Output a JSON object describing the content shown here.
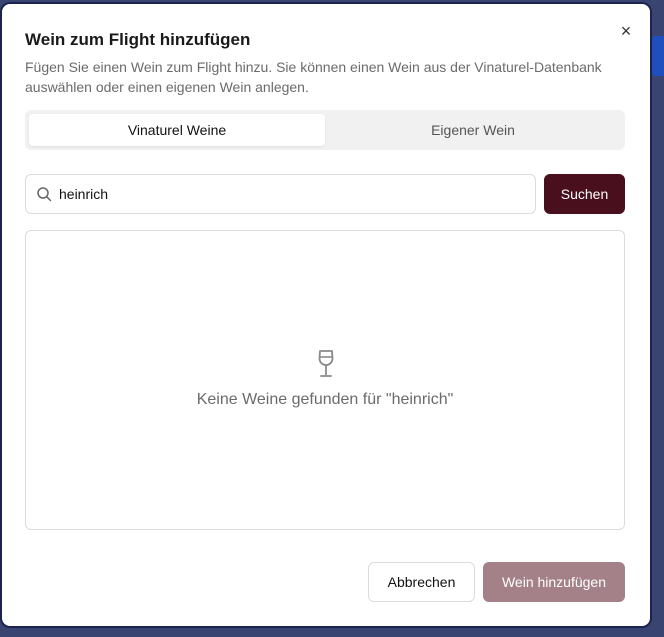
{
  "dialog": {
    "title": "Wein zum Flight hinzufügen",
    "description": "Fügen Sie einen Wein zum Flight hinzu. Sie können einen Wein aus der Vinaturel-Datenbank auswählen oder einen eigenen Wein anlegen.",
    "close_label": "×"
  },
  "tabs": [
    {
      "label": "Vinaturel Weine",
      "active": true
    },
    {
      "label": "Eigener Wein",
      "active": false
    }
  ],
  "search": {
    "value": "heinrich",
    "placeholder": "",
    "button_label": "Suchen"
  },
  "results": {
    "empty_message": "Keine Weine gefunden für \"heinrich\""
  },
  "footer": {
    "cancel_label": "Abbrechen",
    "add_label": "Wein hinzufügen"
  },
  "colors": {
    "primary": "#4a0f1c",
    "primary_disabled": "#a48189",
    "border": "#dcdcdc"
  },
  "icons": [
    "search-icon",
    "wine-glass-icon",
    "close-icon"
  ]
}
